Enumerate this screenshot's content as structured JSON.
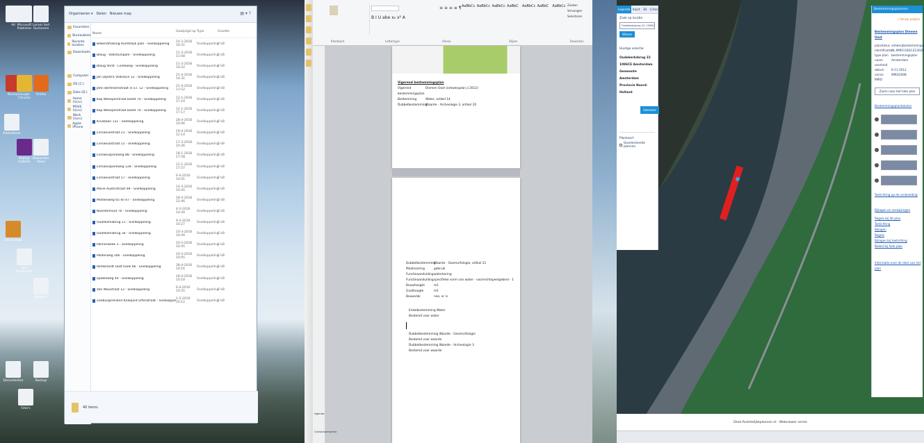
{
  "desktop": {
    "icons": [
      {
        "label": "Ad",
        "color": "#eef2f7"
      },
      {
        "label": "Microsoft Publisher",
        "color": "#eef2f7"
      },
      {
        "label": "Lorem Sed Faciliorem",
        "color": "#eef2f7"
      },
      {
        "label": "Bureau",
        "color": "#c63b2b"
      },
      {
        "label": "Google Chrome",
        "color": "#e4b633"
      },
      {
        "label": "Firefox",
        "color": "#e26a1d"
      },
      {
        "label": "Bibliotheek",
        "color": "#eef2f7"
      },
      {
        "label": "Koptyp Outlook",
        "color": "#6a2a8a"
      },
      {
        "label": "Bestanden Taken",
        "color": "#eef2f7"
      },
      {
        "label": "GIS Bureau",
        "color": "#d58b2a"
      },
      {
        "label": "Lijst bestanden",
        "color": "#eef2f7"
      },
      {
        "label": "Notities",
        "color": "#eef2f7"
      },
      {
        "label": "Documenten",
        "color": "#eef2f7"
      },
      {
        "label": "Foto's",
        "color": "#eef2f7"
      },
      {
        "label": "Backup",
        "color": "#eef2f7"
      }
    ]
  },
  "explorer": {
    "toolbar": {
      "organize": "Organiseren ▾",
      "share": "Delen",
      "new_folder": "Nieuwe map"
    },
    "nav": [
      "Favorieten",
      "Bureaublad",
      "Recente locaties",
      "Downloads",
      "Computer",
      "OS (C:)",
      "Data (D:)",
      "Home (\\\\srv)",
      "PRIVE (\\\\srv)",
      "Werk (\\\\srv)",
      "Apple iPhone"
    ],
    "columns": [
      "Naam",
      "Gewijzigd op",
      "Type",
      "Grootte"
    ],
    "rows": [
      [
        "Bekendmaking Ruimtelijk plan - Snelkoppeling",
        "14-3-2016 10:21",
        "Snelkoppeling",
        "2 kB"
      ],
      [
        "Blaug - Volkstuinpark - Snelkoppeling",
        "11-3-2016 11:08",
        "Snelkoppeling",
        "2 kB"
      ],
      [
        "Blaug Vorst - Lindeweg - Snelkoppeling",
        "11-3-2016 10:22",
        "Snelkoppeling",
        "2 kB"
      ],
      [
        "Jan Dijkstra Volkstuin 12 - Snelkoppeling",
        "21-4-2016 14:31",
        "Snelkoppeling",
        "2 kB"
      ],
      [
        "John Bertelsenstraat in a.l. 12 - Snelkoppeling",
        "21-4-2016 11:52",
        "Snelkoppeling",
        "2 kB"
      ],
      [
        "Kop Weesperstraat bezet 70 - Snelkoppeling",
        "12-1-2016 17:19",
        "Snelkoppeling",
        "2 kB"
      ],
      [
        "Kop Weesperstraat bezet 74 - Snelkoppeling",
        "12-1-2016 17:17",
        "Snelkoppeling",
        "2 kB"
      ],
      [
        "Krusbaan 131 - Snelkoppeling",
        "28-4-2016 10:06",
        "Snelkoppeling",
        "2 kB"
      ],
      [
        "Linnaeusstraat 21 - Snelkoppeling",
        "19-4-2016 12:14",
        "Snelkoppeling",
        "2 kB"
      ],
      [
        "Linnaeusstraat 21 - Snelkoppeling",
        "17-3-2016 10:36",
        "Snelkoppeling",
        "2 kB"
      ],
      [
        "Linnaeusparkweg 88 - Snelkoppeling",
        "18-1-2016 17:58",
        "Snelkoppeling",
        "2 kB"
      ],
      [
        "Linnaeusparkweg 128 - Snelkoppeling",
        "12-1-2016 17:57",
        "Snelkoppeling",
        "2 kB"
      ],
      [
        "Linnaeusstraat 57 - Snelkoppeling",
        "6-4-2016 14:01",
        "Snelkoppeling",
        "2 kB"
      ],
      [
        "Marie Austinstraat 99 - Snelkoppeling",
        "14-3-2016 10:45",
        "Snelkoppeling",
        "2 kB"
      ],
      [
        "Middenweg 65 en 67 - Snelkoppeling",
        "18-4-2016 12:46",
        "Snelkoppeling",
        "2 kB"
      ],
      [
        "Noordenhout 76 - Snelkoppeling",
        "4-3-2016 14:44",
        "Snelkoppeling",
        "2 kB"
      ],
      [
        "Oudekerksbrug 11 - Snelkoppeling",
        "9-3-2016 10:27",
        "Snelkoppeling",
        "2 kB"
      ],
      [
        "Oudekerksbrug 34 - Snelkoppeling",
        "10-3-2016 10:49",
        "Snelkoppeling",
        "2 kB"
      ],
      [
        "Pannenkoek 3 - Snelkoppeling",
        "10-3-2016 10:45",
        "Snelkoppeling",
        "2 kB"
      ],
      [
        "Polderweg 346 - Snelkoppeling",
        "10-3-2016 10:05",
        "Snelkoppeling",
        "2 kB"
      ],
      [
        "Rembrandt Oost hoek 66 - Snelkoppeling",
        "28-4-2016 10:16",
        "Snelkoppeling",
        "2 kB"
      ],
      [
        "Spakleweg 44 - Snelkoppeling",
        "18-4-2016 10:18",
        "Snelkoppeling",
        "2 kB"
      ],
      [
        "Van Woustraat 12 - Snelkoppeling",
        "6-4-2016 10:35",
        "Snelkoppeling",
        "2 kB"
      ],
      [
        "Zeeburgereiland Knelpunt Effenstraat - Snelkoppeling",
        "1-5-2016 10:12",
        "Snelkoppeling",
        "2 kB"
      ]
    ],
    "status": "40 items"
  },
  "word": {
    "ribbon": {
      "groups": [
        "Klembord",
        "Lettertype",
        "Alinea",
        "Stijlen",
        "Bewerken"
      ],
      "styles": [
        "AaBbCc",
        "AaBbCc",
        "AaBbCc",
        "AaBbC",
        "AaBbCc",
        "AaBbC",
        "AaBbCc"
      ],
      "find": "Zoeken",
      "replace": "Vervangen",
      "select": "Selecteren"
    },
    "left_items": [
      "Agenda",
      "Contactpersonen"
    ],
    "page1": {
      "section": "Vigerend bestemmingsplan",
      "kv": [
        [
          "Vigerend bestemmingsplan",
          "Diemen Oost (ontwerpplan ji 2012)"
        ],
        [
          "Bestemming",
          "Water, artikel 14"
        ],
        [
          "Dubbelbestemming",
          "Waarde - Archeologie 3, artikel 20"
        ]
      ]
    },
    "page2": {
      "kv": [
        [
          "Dubbelbestemming",
          "Waarde - Geomorfologie, artikel 21"
        ],
        [
          "Maatvoering",
          "gebruik"
        ],
        [
          "Functieaanduiding",
          "waterkering"
        ],
        [
          "Functieaanduiding",
          "specifieke vorm van water - voorrechtspeelgebied - 1"
        ],
        [
          "Bouwhoogte",
          "m1"
        ],
        [
          "Goothoogte",
          "m1"
        ],
        [
          "Bouwvlak",
          "nee, er is"
        ]
      ],
      "lines_a": [
        "Enkelbestemming Water",
        "Bestemd voor water"
      ],
      "lines_b": [
        "Dubbelbestemming Waarde - Geomorfologie",
        "Bestemd voor waarde",
        "Dubbelbestemming Waarde - Archeologie 3",
        "Bestemd voor waarde"
      ]
    }
  },
  "map": {
    "left_panel": {
      "tabs": [
        "Legenda",
        "Kaart",
        "3D",
        "Criteria"
      ],
      "search_label": "Zoek op locatie",
      "search_value": "Oudekerksbrug 22, 1096CE Amsterdam",
      "search_button": "Wissen",
      "results_title": "Huidige selectie:",
      "results": [
        "Oudekerksbrug 22",
        "1096CE Amsterdam",
        "Gemeente Amsterdam",
        "Provincie Noord-Holland"
      ],
      "select_button": "Selecteer",
      "layers_label": "Plankaart",
      "layers_option": "Geselecteerde plannen"
    },
    "right_panel": {
      "title": "Bestemmingsplannen",
      "back": "« Vorige pagina",
      "plan_title": "Bestemmingsplan Diemen Oost",
      "details": [
        [
          "planstatus",
          "ontwerpbestemmingsplan"
        ],
        [
          "identificatie",
          "NL.IMRO.0363.E1302BPGST"
        ],
        [
          "type plan",
          "bestemmingsplan"
        ],
        [
          "naam overheid",
          "Amsterdam"
        ],
        [
          "datum",
          "6-11-2012"
        ],
        [
          "versie IMRO",
          "IMRO2008"
        ]
      ],
      "zoom_button": "Zoom naar het hele plan",
      "section_planteksten": "Bestemmingsplanteksten",
      "section_toelichting": "Toelichting op de verbeelding",
      "section_links": "Bijlagen en verwijzingen",
      "links": [
        "Regels bij dit plan",
        "Toelichting",
        "Bijlagen",
        "Regels",
        "Bijlagen bij toelichting",
        "Beleid bij hele plan"
      ],
      "footer_link": "Informatie over de deel van het plan"
    },
    "footer": "Deze Ruimtelijkeplannen.nl - Webviewer versie"
  }
}
